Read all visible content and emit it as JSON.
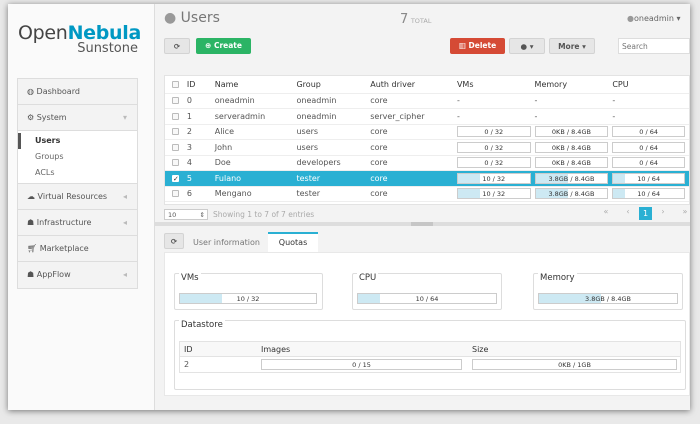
{
  "logo": {
    "open": "Open",
    "nebula": "Nebula",
    "sunstone": "Sunstone"
  },
  "sidebar": {
    "items": [
      {
        "label": "Dashboard",
        "icon": "dashboard-icon"
      },
      {
        "label": "System",
        "icon": "cogs-icon",
        "sub": [
          "Users",
          "Groups",
          "ACLs"
        ]
      },
      {
        "label": "Virtual Resources",
        "icon": "cloud-icon"
      },
      {
        "label": "Infrastructure",
        "icon": "sitemap-icon"
      },
      {
        "label": "Marketplace",
        "icon": "cart-icon"
      },
      {
        "label": "AppFlow",
        "icon": "sitemap-icon"
      }
    ]
  },
  "header": {
    "title": "Users",
    "total_count": "7",
    "total_label": "TOTAL",
    "user": "oneadmin"
  },
  "toolbar": {
    "create": "Create",
    "delete": "Delete",
    "more": "More",
    "search_placeholder": "Search"
  },
  "table": {
    "columns": [
      "ID",
      "Name",
      "Group",
      "Auth driver",
      "VMs",
      "Memory",
      "CPU"
    ],
    "rows": [
      {
        "id": "0",
        "name": "oneadmin",
        "group": "oneadmin",
        "auth": "core",
        "vms": "-",
        "mem": "-",
        "cpu": "-"
      },
      {
        "id": "1",
        "name": "serveradmin",
        "group": "oneadmin",
        "auth": "server_cipher",
        "vms": "-",
        "mem": "-",
        "cpu": "-"
      },
      {
        "id": "2",
        "name": "Alice",
        "group": "users",
        "auth": "core",
        "vms": "0 / 32",
        "vms_pct": 0,
        "mem": "0KB / 8.4GB",
        "mem_pct": 0,
        "cpu": "0 / 64",
        "cpu_pct": 0
      },
      {
        "id": "3",
        "name": "John",
        "group": "users",
        "auth": "core",
        "vms": "0 / 32",
        "vms_pct": 0,
        "mem": "0KB / 8.4GB",
        "mem_pct": 0,
        "cpu": "0 / 64",
        "cpu_pct": 0
      },
      {
        "id": "4",
        "name": "Doe",
        "group": "developers",
        "auth": "core",
        "vms": "0 / 32",
        "vms_pct": 0,
        "mem": "0KB / 8.4GB",
        "mem_pct": 0,
        "cpu": "0 / 64",
        "cpu_pct": 0
      },
      {
        "id": "5",
        "name": "Fulano",
        "group": "tester",
        "auth": "core",
        "vms": "10 / 32",
        "vms_pct": 31,
        "mem": "3.8GB / 8.4GB",
        "mem_pct": 45,
        "cpu": "10 / 64",
        "cpu_pct": 16,
        "selected": true
      },
      {
        "id": "6",
        "name": "Mengano",
        "group": "tester",
        "auth": "core",
        "vms": "10 / 32",
        "vms_pct": 31,
        "mem": "3.8GB / 8.4GB",
        "mem_pct": 45,
        "cpu": "10 / 64",
        "cpu_pct": 16
      }
    ]
  },
  "footer": {
    "page_size": "10",
    "showing": "Showing 1 to 7 of 7 entries",
    "page": "1",
    "first": "«",
    "prev": "‹",
    "next": "›",
    "last": "»"
  },
  "detail": {
    "tabs": [
      "User information",
      "Quotas"
    ],
    "quotas": {
      "vms": {
        "label": "VMs",
        "value": "10 / 32",
        "pct": 31
      },
      "cpu": {
        "label": "CPU",
        "value": "10 / 64",
        "pct": 16
      },
      "memory": {
        "label": "Memory",
        "value": "3.8GB / 8.4GB",
        "pct": 45
      }
    },
    "datastore": {
      "title": "Datastore",
      "columns": [
        "ID",
        "Images",
        "Size"
      ],
      "rows": [
        {
          "id": "2",
          "images": "0 / 15",
          "size": "0KB / 1GB"
        }
      ]
    }
  }
}
